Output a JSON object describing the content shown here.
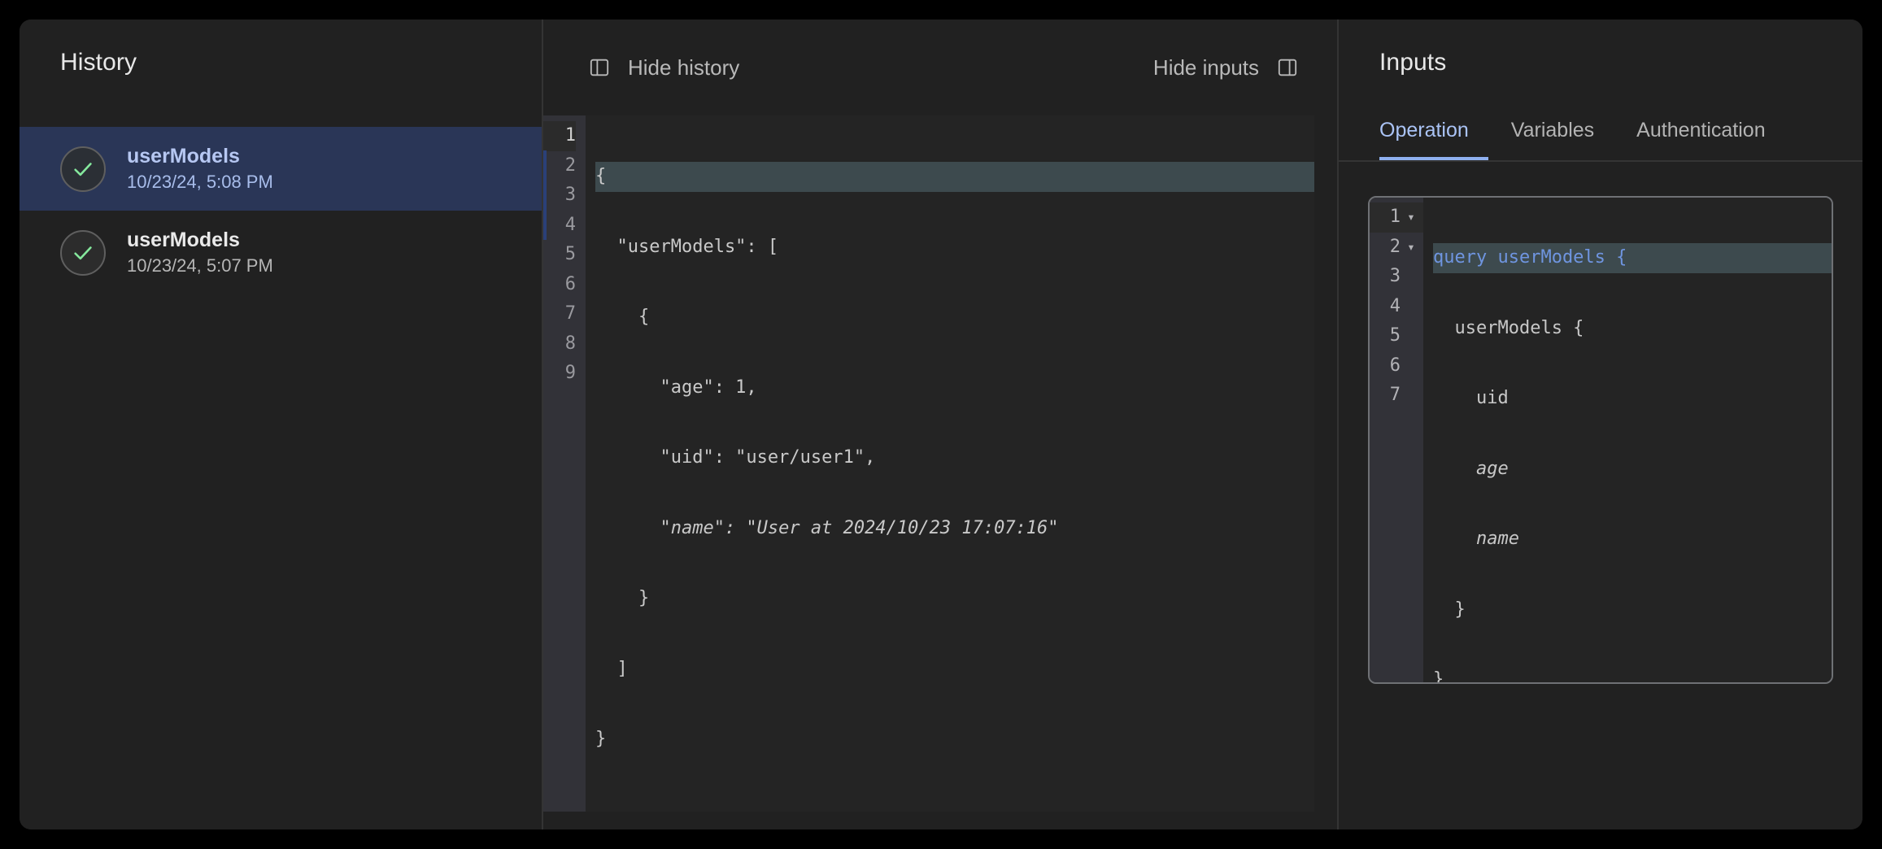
{
  "history": {
    "title": "History",
    "items": [
      {
        "name": "userModels",
        "timestamp": "10/23/24, 5:08 PM",
        "status_icon": "check-icon",
        "selected": true
      },
      {
        "name": "userModels",
        "timestamp": "10/23/24, 5:07 PM",
        "status_icon": "check-icon",
        "selected": false
      }
    ]
  },
  "toolbar": {
    "hide_history_label": "Hide history",
    "hide_history_icon": "panel-left-icon",
    "hide_inputs_label": "Hide inputs",
    "hide_inputs_icon": "panel-right-icon"
  },
  "response": {
    "line_numbers": [
      "1",
      "2",
      "3",
      "4",
      "5",
      "6",
      "7",
      "8",
      "9"
    ],
    "lines": [
      "{",
      "  \"userModels\": [",
      "    {",
      "      \"age\": 1,",
      "      \"uid\": \"user/user1\",",
      "      \"name\": \"User at 2024/10/23 17:07:16\"",
      "    }",
      "  ]",
      "}"
    ],
    "active_line": 1
  },
  "inputs": {
    "title": "Inputs",
    "tabs": [
      {
        "label": "Operation",
        "active": true
      },
      {
        "label": "Variables",
        "active": false
      },
      {
        "label": "Authentication",
        "active": false
      }
    ],
    "operation_editor": {
      "line_numbers": [
        "1",
        "2",
        "3",
        "4",
        "5",
        "6",
        "7"
      ],
      "fold_markers": [
        "chevron-down-icon",
        "chevron-down-icon",
        "",
        "",
        "",
        "",
        ""
      ],
      "lines": [
        {
          "keyword": "query userModels {",
          "rest": ""
        },
        {
          "keyword": "",
          "rest": "  userModels {"
        },
        {
          "keyword": "",
          "rest": "    uid"
        },
        {
          "keyword": "",
          "rest": "    age"
        },
        {
          "keyword": "",
          "rest": "    name"
        },
        {
          "keyword": "",
          "rest": "  }"
        },
        {
          "keyword": "",
          "rest": "}"
        }
      ],
      "active_line": 1
    }
  },
  "colors": {
    "page_background": "#000000",
    "panel_background": "#212121",
    "selection_blue": "#2a3657",
    "accent_blue": "#8fb0ef",
    "keyword_blue": "#6f95e0",
    "success_green": "#85e89d",
    "active_line": "#3d4a4e",
    "gutter": "#323238"
  }
}
